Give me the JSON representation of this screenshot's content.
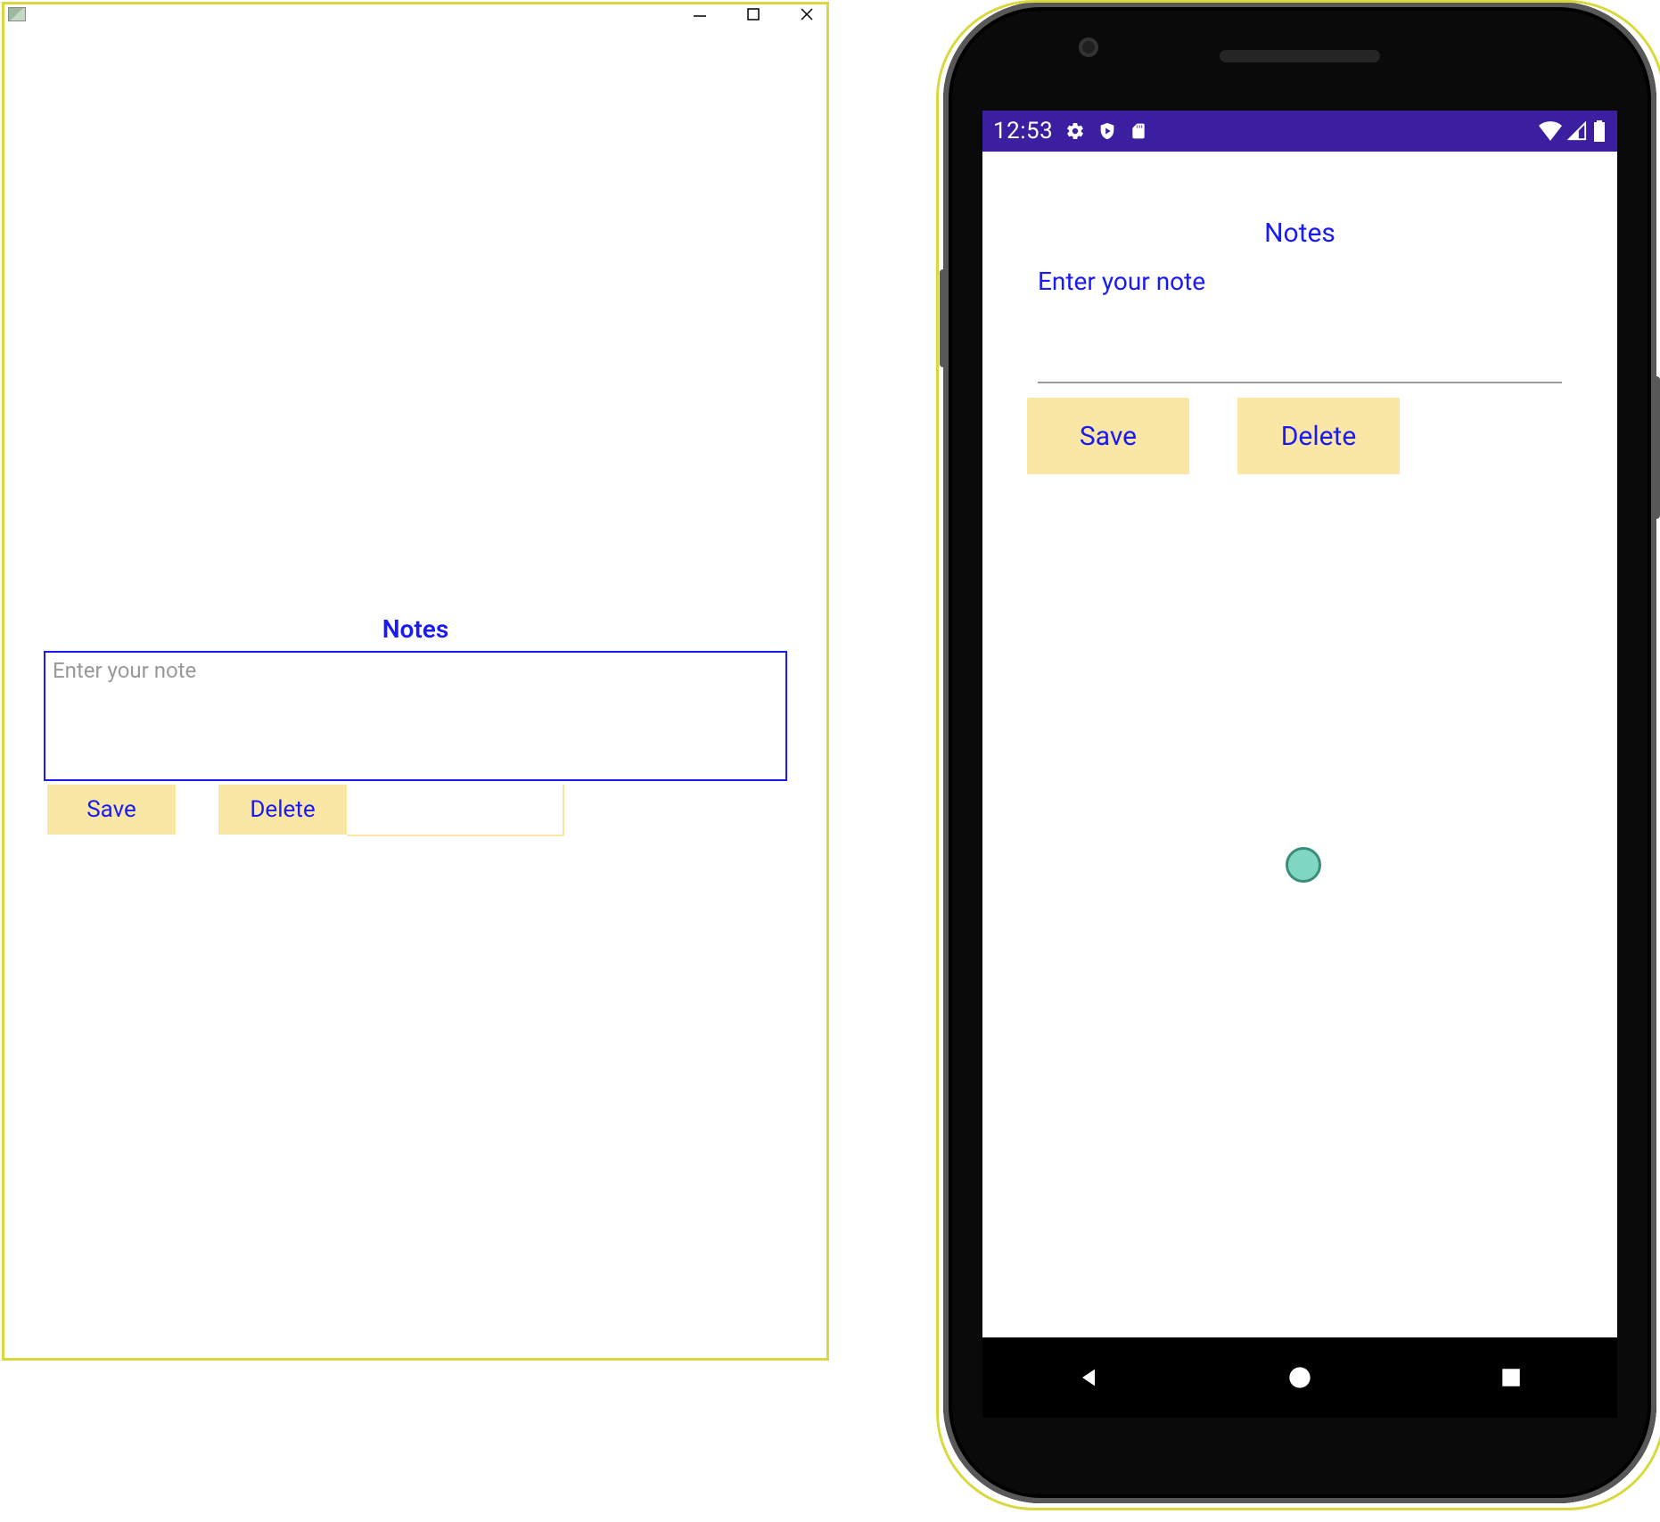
{
  "desktop": {
    "title_icon": "app-icon",
    "notes_title": "Notes",
    "note_placeholder": "Enter your note",
    "save_label": "Save",
    "delete_label": "Delete"
  },
  "phone": {
    "statusbar": {
      "time": "12:53",
      "icons_left": [
        "gear-icon",
        "shield-play-icon",
        "sd-card-icon"
      ],
      "icons_right": [
        "wifi-icon",
        "cell-signal-icon",
        "battery-icon"
      ]
    },
    "notes_title": "Notes",
    "note_placeholder": "Enter your note",
    "save_label": "Save",
    "delete_label": "Delete"
  }
}
